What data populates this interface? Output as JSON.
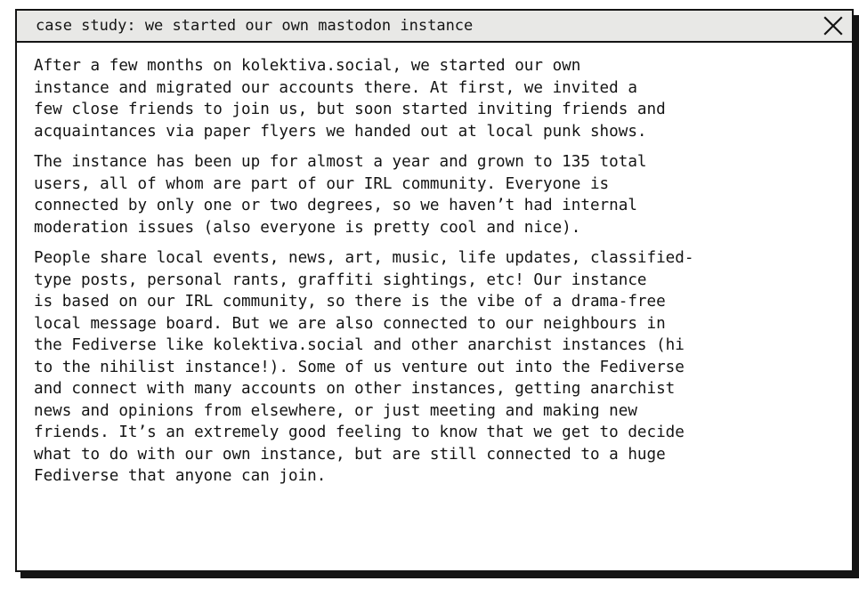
{
  "window": {
    "title": "case study: we started our own mastodon instance",
    "close_icon": "close-icon"
  },
  "paragraphs": [
    {
      "lines": [
        "After a few months on kolektiva.social, we started our own",
        "instance and migrated our accounts there. At first, we invited a",
        "few close friends to join us, but soon started inviting friends and",
        "acquaintances via paper flyers we handed out at local punk shows."
      ]
    },
    {
      "lines": [
        "The instance has been up for almost a year and grown to 135 total",
        "users, all of whom are part of our IRL community. Everyone is",
        "connected by only one or two degrees, so we haven’t had internal",
        "moderation issues (also everyone is pretty cool and nice)."
      ]
    },
    {
      "lines": [
        "People share local events, news, art, music, life updates, classified-",
        "type posts, personal rants, graffiti sightings, etc! Our instance",
        "is based on our IRL community, so there is the vibe of a drama-free",
        "local message board. But we are also connected to our neighbours in",
        "the Fediverse like kolektiva.social and other anarchist instances (hi",
        "to the nihilist instance!). Some of us venture out into the Fediverse",
        "and connect with many accounts on other instances, getting anarchist",
        "news and opinions from elsewhere, or just meeting and making new",
        "friends. It’s an extremely good feeling to know that we get to decide",
        "what to do with our own instance, but are still connected to a huge",
        "Fediverse that anyone can join."
      ]
    }
  ]
}
